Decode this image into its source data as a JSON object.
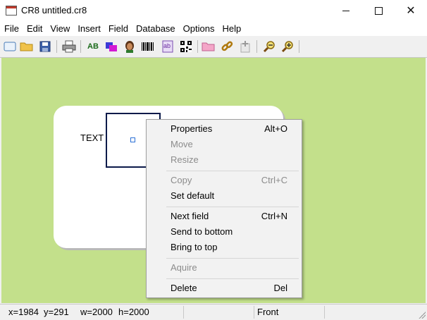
{
  "window": {
    "title": "CR8 untitled.cr8"
  },
  "menubar": {
    "items": [
      "File",
      "Edit",
      "View",
      "Insert",
      "Field",
      "Database",
      "Options",
      "Help"
    ]
  },
  "toolbar": {
    "icons": [
      "new-icon",
      "open-folder-icon",
      "save-icon",
      "print-icon",
      "text-field-icon",
      "shape-icon",
      "photo-icon",
      "barcode-icon",
      "abc-icon",
      "qr-code-icon",
      "folder-pink-icon",
      "link-icon",
      "add-field-icon",
      "zoom-out-icon",
      "zoom-in-icon"
    ],
    "text_field_label": "AB",
    "abc_label": "ab"
  },
  "canvas": {
    "background": "#c3e08b",
    "card_text": "TEXT"
  },
  "context_menu": {
    "items": [
      {
        "label": "Properties",
        "shortcut": "Alt+O",
        "enabled": true
      },
      {
        "label": "Move",
        "shortcut": "",
        "enabled": false
      },
      {
        "label": "Resize",
        "shortcut": "",
        "enabled": false
      },
      {
        "label": "Copy",
        "shortcut": "Ctrl+C",
        "enabled": false
      },
      {
        "label": "Set default",
        "shortcut": "",
        "enabled": true
      },
      {
        "label": "Next field",
        "shortcut": "Ctrl+N",
        "enabled": true
      },
      {
        "label": "Send to bottom",
        "shortcut": "",
        "enabled": true
      },
      {
        "label": "Bring to top",
        "shortcut": "",
        "enabled": true
      },
      {
        "label": "Aquire",
        "shortcut": "",
        "enabled": false
      },
      {
        "label": "Delete",
        "shortcut": "Del",
        "enabled": true
      }
    ]
  },
  "statusbar": {
    "x": "x=1984",
    "y": "y=291",
    "w": "w=2000",
    "h": "h=2000",
    "mode": "Front"
  }
}
